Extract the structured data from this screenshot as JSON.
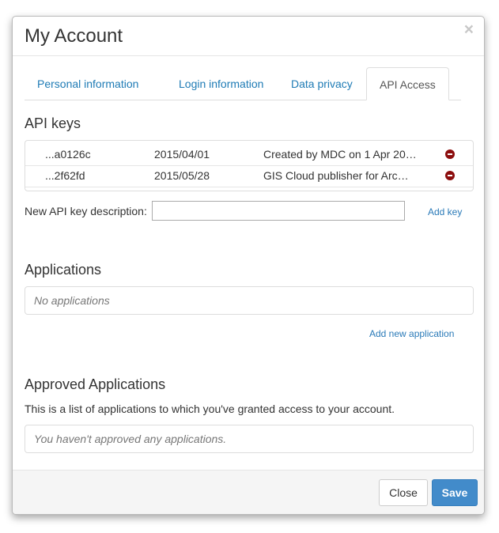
{
  "dialog": {
    "title": "My Account",
    "close_icon": "×"
  },
  "tabs": [
    {
      "label": "Personal information",
      "active": false
    },
    {
      "label": "Login information",
      "active": false
    },
    {
      "label": "Data privacy",
      "active": false
    },
    {
      "label": "API Access",
      "active": true
    }
  ],
  "api_keys": {
    "title": "API keys",
    "rows": [
      {
        "key": "...a0126c",
        "date": "2015/04/01",
        "description": "Created by MDC on 1 Apr 20…",
        "remove_icon": "remove-icon"
      },
      {
        "key": "...2f62fd",
        "date": "2015/05/28",
        "description": "GIS Cloud publisher for Arc…",
        "remove_icon": "remove-icon"
      }
    ],
    "new_label": "New API key description:",
    "new_value": "",
    "add_label": "Add key"
  },
  "applications": {
    "title": "Applications",
    "empty_text": "No applications",
    "add_label": "Add new application"
  },
  "approved": {
    "title": "Approved Applications",
    "description": "This is a list of applications to which you've granted access to your account.",
    "empty_text": "You haven't approved any applications."
  },
  "footer": {
    "close_label": "Close",
    "save_label": "Save"
  },
  "colors": {
    "link": "#1e7bb5",
    "primary": "#428bca",
    "remove": "#8c0d0d"
  }
}
